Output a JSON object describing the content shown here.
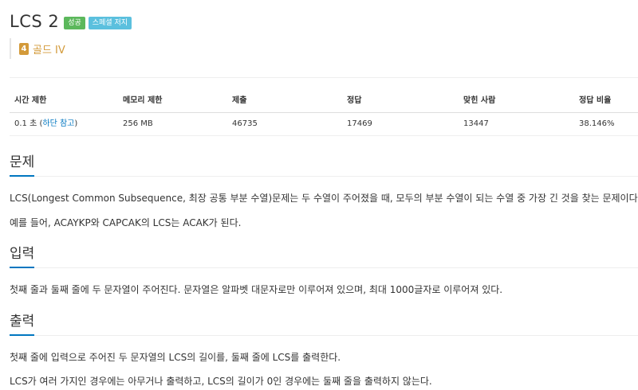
{
  "problem": {
    "title": "LCS 2",
    "badges": {
      "success": "성공",
      "special": "스페셜 저지"
    },
    "tier": {
      "icon_number": "4",
      "label": "골드 IV",
      "color": "#d39a3a"
    }
  },
  "stats": {
    "headers": [
      "시간 제한",
      "메모리 제한",
      "제출",
      "정답",
      "맞힌 사람",
      "정답 비율"
    ],
    "time_limit": "0.1 초 (",
    "time_link": "하단 참고",
    "time_close": ")",
    "memory": "256 MB",
    "submissions": "46735",
    "accepted": "17469",
    "solvers": "13447",
    "ratio": "38.146%"
  },
  "sections": {
    "problem": {
      "heading": "문제",
      "paragraphs": [
        "LCS(Longest Common Subsequence, 최장 공통 부분 수열)문제는 두 수열이 주어졌을 때, 모두의 부분 수열이 되는 수열 중 가장 긴 것을 찾는 문제이다.",
        "예를 들어, ACAYKP와 CAPCAK의 LCS는 ACAK가 된다."
      ]
    },
    "input": {
      "heading": "입력",
      "paragraphs": [
        "첫째 줄과 둘째 줄에 두 문자열이 주어진다. 문자열은 알파벳 대문자로만 이루어져 있으며, 최대 1000글자로 이루어져 있다."
      ]
    },
    "output": {
      "heading": "출력",
      "paragraphs": [
        "첫째 줄에 입력으로 주어진 두 문자열의 LCS의 길이를, 둘째 줄에 LCS를 출력한다.",
        "LCS가 여러 가지인 경우에는 아무거나 출력하고, LCS의 길이가 0인 경우에는 둘째 줄을 출력하지 않는다."
      ]
    }
  },
  "colors": {
    "accent": "#0076c0",
    "success": "#5cb85c",
    "special": "#5bc0de"
  }
}
